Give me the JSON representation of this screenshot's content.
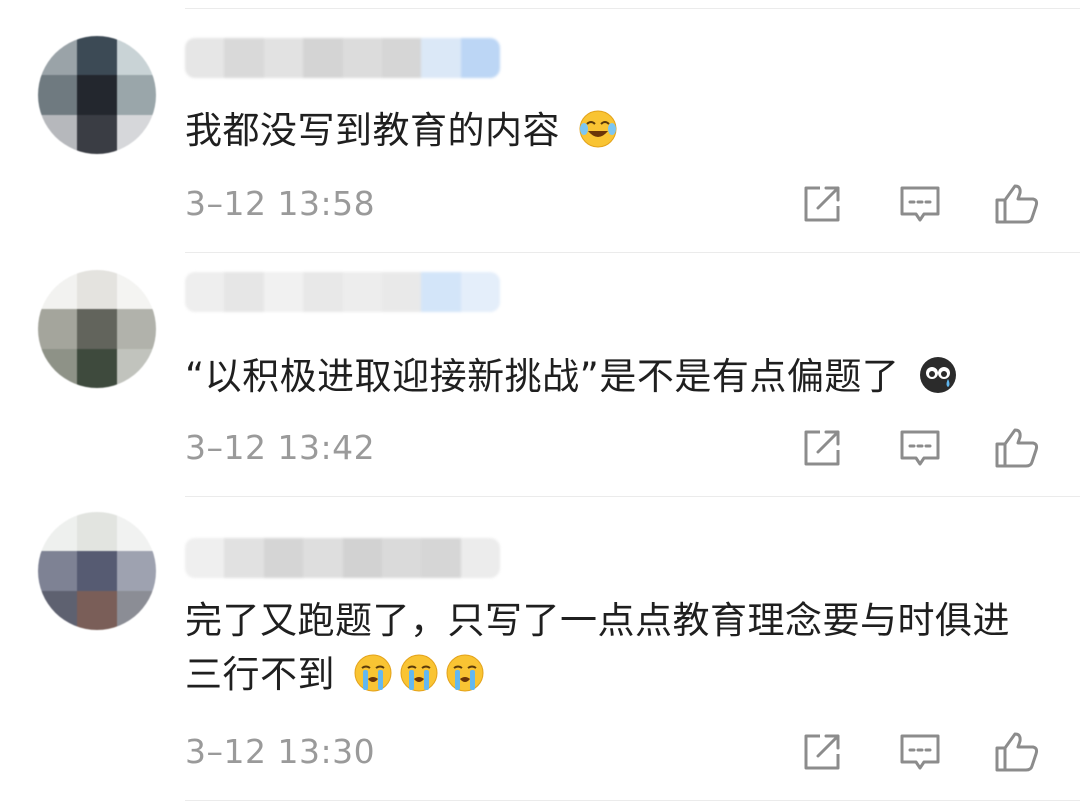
{
  "comments": [
    {
      "text": "我都没写到教育的内容",
      "emojis": [
        "laugh-cry-emoji"
      ],
      "time": "3–12 13:58"
    },
    {
      "text": "“以积极进取迎接新挑战”是不是有点偏题了",
      "emojis": [
        "crying-black-face-emoji"
      ],
      "time": "3–12 13:42"
    },
    {
      "text": "完了又跑题了，只写了一点点教育理念要与时俱进三行不到",
      "emojis": [
        "loud-crying-emoji",
        "loud-crying-emoji",
        "loud-crying-emoji"
      ],
      "time": "3–12 13:30"
    }
  ],
  "actions": [
    "share-icon",
    "reply-icon",
    "like-icon"
  ],
  "colors": {
    "text": "#1f1f1f",
    "meta": "#9a9a9a",
    "icon": "#8c8c8c",
    "divider": "#ebebeb"
  }
}
